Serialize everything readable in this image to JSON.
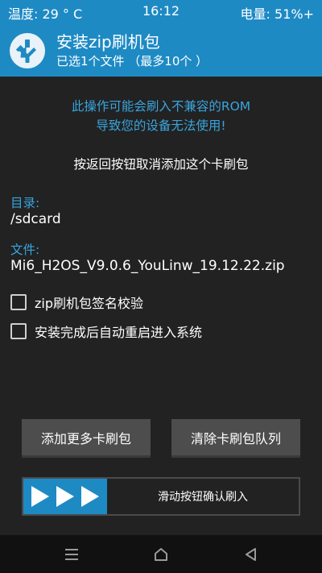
{
  "status_bar": {
    "temperature": "温度: 29 ° C",
    "time": "16:12",
    "battery": "电量: 51%+"
  },
  "header": {
    "title": "安装zip刷机包",
    "subtitle": "已选1个文件 （最多10个 ）",
    "logo_icon": "twrp-logo-icon"
  },
  "warning": {
    "line1": "此操作可能会刷入不兼容的ROM",
    "line2": "导致您的设备无法使用!"
  },
  "hint": "按返回按钮取消添加这个卡刷包",
  "directory": {
    "label": "目录:",
    "value": "/sdcard"
  },
  "file": {
    "label": "文件:",
    "value": "Mi6_H2OS_V9.0.6_YouLinw_19.12.22.zip"
  },
  "options": [
    {
      "label": "zip刷机包签名校验",
      "checked": false
    },
    {
      "label": "安装完成后自动重启进入系统",
      "checked": false
    }
  ],
  "buttons": {
    "add_more": "添加更多卡刷包",
    "clear_queue": "清除卡刷包队列"
  },
  "slider": {
    "label": "滑动按钮确认刷入",
    "icon": "triple-arrow-icon"
  },
  "nav": {
    "menu_icon": "menu-icon",
    "home_icon": "home-icon",
    "back_icon": "back-icon"
  },
  "colors": {
    "accent": "#1e8ac4",
    "accent_text": "#39a5de",
    "background": "#222222",
    "button": "#4d4d4d",
    "nav_bar": "#111111"
  }
}
